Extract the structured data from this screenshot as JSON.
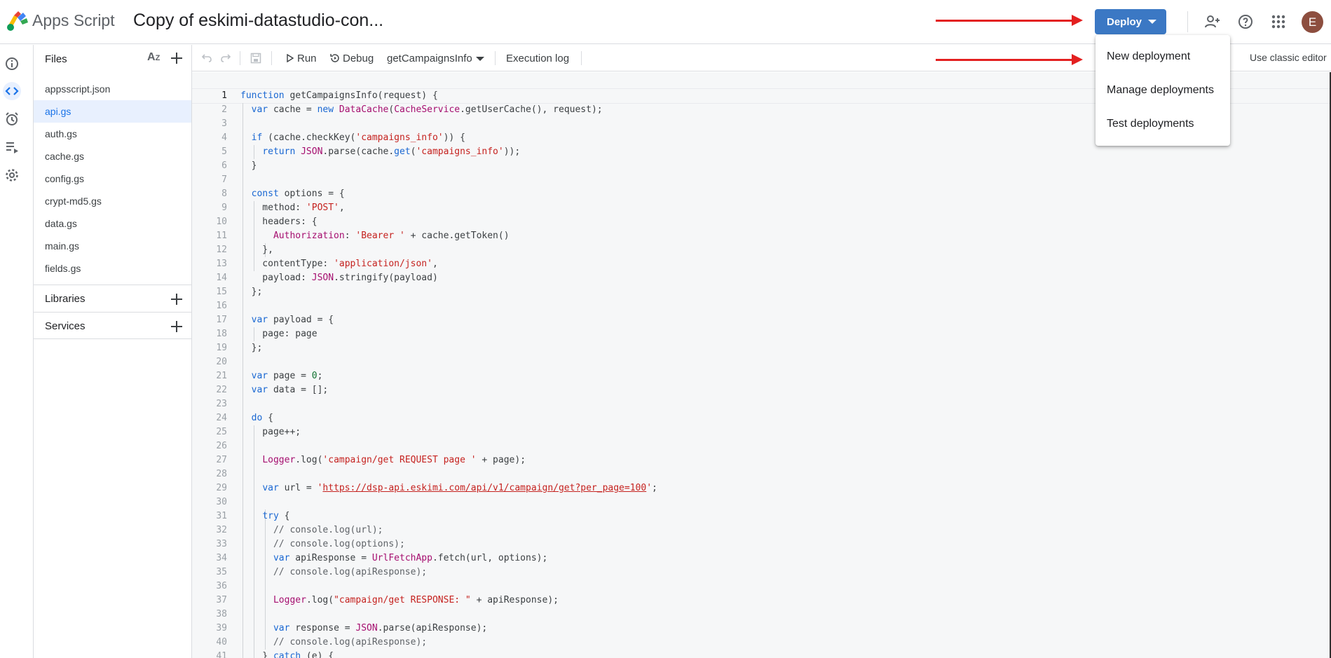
{
  "header": {
    "app_name": "Apps Script",
    "project_title": "Copy of eskimi-datastudio-con...",
    "deploy_label": "Deploy",
    "avatar_initial": "E",
    "icons": [
      "logo-icon",
      "share-icon",
      "help-icon",
      "apps-grid-icon"
    ],
    "accent_color": "#3b78c4"
  },
  "rail": {
    "items": [
      {
        "name": "overview",
        "icon": "info-icon"
      },
      {
        "name": "editor",
        "icon": "code-icon",
        "active": true
      },
      {
        "name": "triggers",
        "icon": "alarm-icon"
      },
      {
        "name": "executions",
        "icon": "executions-icon"
      },
      {
        "name": "settings",
        "icon": "gear-icon"
      }
    ]
  },
  "files_panel": {
    "title": "Files",
    "sort_label": "AZ",
    "files": [
      "appsscript.json",
      "api.gs",
      "auth.gs",
      "cache.gs",
      "config.gs",
      "crypt-md5.gs",
      "data.gs",
      "main.gs",
      "fields.gs"
    ],
    "active_file": "api.gs",
    "libraries_label": "Libraries",
    "services_label": "Services"
  },
  "toolbar": {
    "run_label": "Run",
    "debug_label": "Debug",
    "function_select": "getCampaignsInfo",
    "execution_log_label": "Execution log",
    "classic_editor_label": "Use classic editor"
  },
  "deploy_menu": {
    "items": [
      "New deployment",
      "Manage deployments",
      "Test deployments"
    ]
  },
  "editor": {
    "current_line": 1,
    "line_numbers": [
      "1",
      "2",
      "3",
      "4",
      "5",
      "6",
      "7",
      "8",
      "9",
      "10",
      "11",
      "12",
      "13",
      "14",
      "15",
      "16",
      "17",
      "18",
      "19",
      "20",
      "21",
      "22",
      "23",
      "24",
      "25",
      "26",
      "27",
      "28",
      "29",
      "30",
      "31",
      "32",
      "33",
      "34",
      "35",
      "36",
      "37",
      "38",
      "39",
      "40",
      "41"
    ],
    "lines": [
      "function getCampaignsInfo(request) {",
      "  var cache = new DataCache(CacheService.getUserCache(), request);",
      "",
      "  if (cache.checkKey('campaigns_info')) {",
      "    return JSON.parse(cache.get('campaigns_info'));",
      "  }",
      "",
      "  const options = {",
      "    method: 'POST',",
      "    headers: {",
      "      Authorization: 'Bearer ' + cache.getToken()",
      "    },",
      "    contentType: 'application/json',",
      "    payload: JSON.stringify(payload)",
      "  };",
      "",
      "  var payload = {",
      "    page: page",
      "  };",
      "",
      "  var page = 0;",
      "  var data = [];",
      "",
      "  do {",
      "    page++;",
      "",
      "    Logger.log('campaign/get REQUEST page ' + page);",
      "",
      "    var url = 'https://dsp-api.eskimi.com/api/v1/campaign/get?per_page=100';",
      "",
      "    try {",
      "      // console.log(url);",
      "      // console.log(options);",
      "      var apiResponse = UrlFetchApp.fetch(url, options);",
      "      // console.log(apiResponse);",
      "",
      "      Logger.log(\"campaign/get RESPONSE: \" + apiResponse);",
      "",
      "      var response = JSON.parse(apiResponse);",
      "      // console.log(apiResponse);",
      "    } catch (e) {"
    ]
  }
}
